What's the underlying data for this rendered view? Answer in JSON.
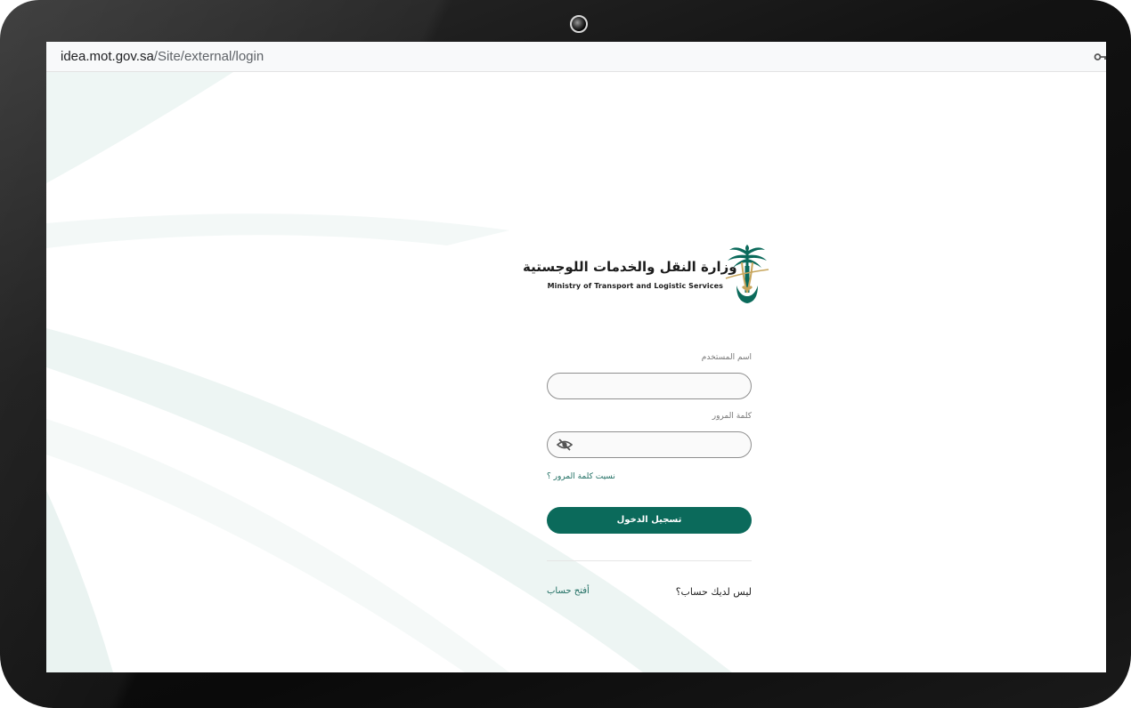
{
  "browser": {
    "url_domain": "idea.mot.gov.sa",
    "url_path": "/Site/external/login",
    "key_icon": "key-icon"
  },
  "branding": {
    "name_ar": "وزارة النقل والخدمات اللوجستية",
    "name_en": "Ministry of Transport and Logistic Services",
    "emblem_icon": "palm-swords-emblem",
    "accent_color": "#0b6a5b",
    "gold_color": "#c7a55c"
  },
  "login_form": {
    "username_label": "اسم المستخدم",
    "username_value": "",
    "password_label": "كلمة المرور",
    "password_value": "",
    "password_toggle_icon": "eye-slash-icon",
    "forgot_password": "نسيت كلمة المرور ؟",
    "submit_label": "تسجيل الدخول"
  },
  "signup": {
    "prompt": "ليس لديك حساب؟",
    "link": "أفتح حساب"
  }
}
